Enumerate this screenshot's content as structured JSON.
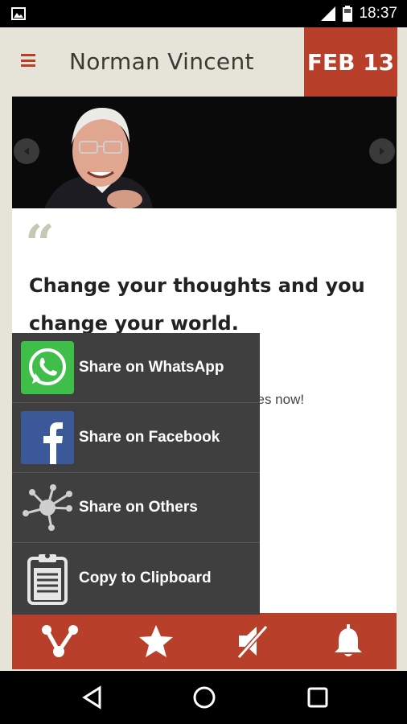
{
  "status_bar": {
    "time": "18:37",
    "icons": [
      "picture-icon",
      "signal-icon",
      "battery-icon"
    ]
  },
  "header": {
    "menu_icon": "hamburger-icon",
    "title": "Norman Vincent",
    "date": "FEB 13"
  },
  "quote": {
    "text": "Change your thoughts and you change your world.",
    "obscured_text": "ites now!"
  },
  "share_menu": {
    "items": [
      {
        "label": "Share on WhatsApp",
        "icon": "whatsapp-icon"
      },
      {
        "label": "Share on Facebook",
        "icon": "facebook-icon"
      },
      {
        "label": "Share on Others",
        "icon": "share-network-icon"
      },
      {
        "label": "Copy to Clipboard",
        "icon": "clipboard-icon"
      }
    ]
  },
  "toolbar": {
    "buttons": [
      "share-icon",
      "star-icon",
      "mute-icon",
      "bell-icon"
    ]
  },
  "colors": {
    "accent": "#b8402a",
    "background": "#e6e4d8",
    "menu_bg": "#3f3f3f"
  }
}
